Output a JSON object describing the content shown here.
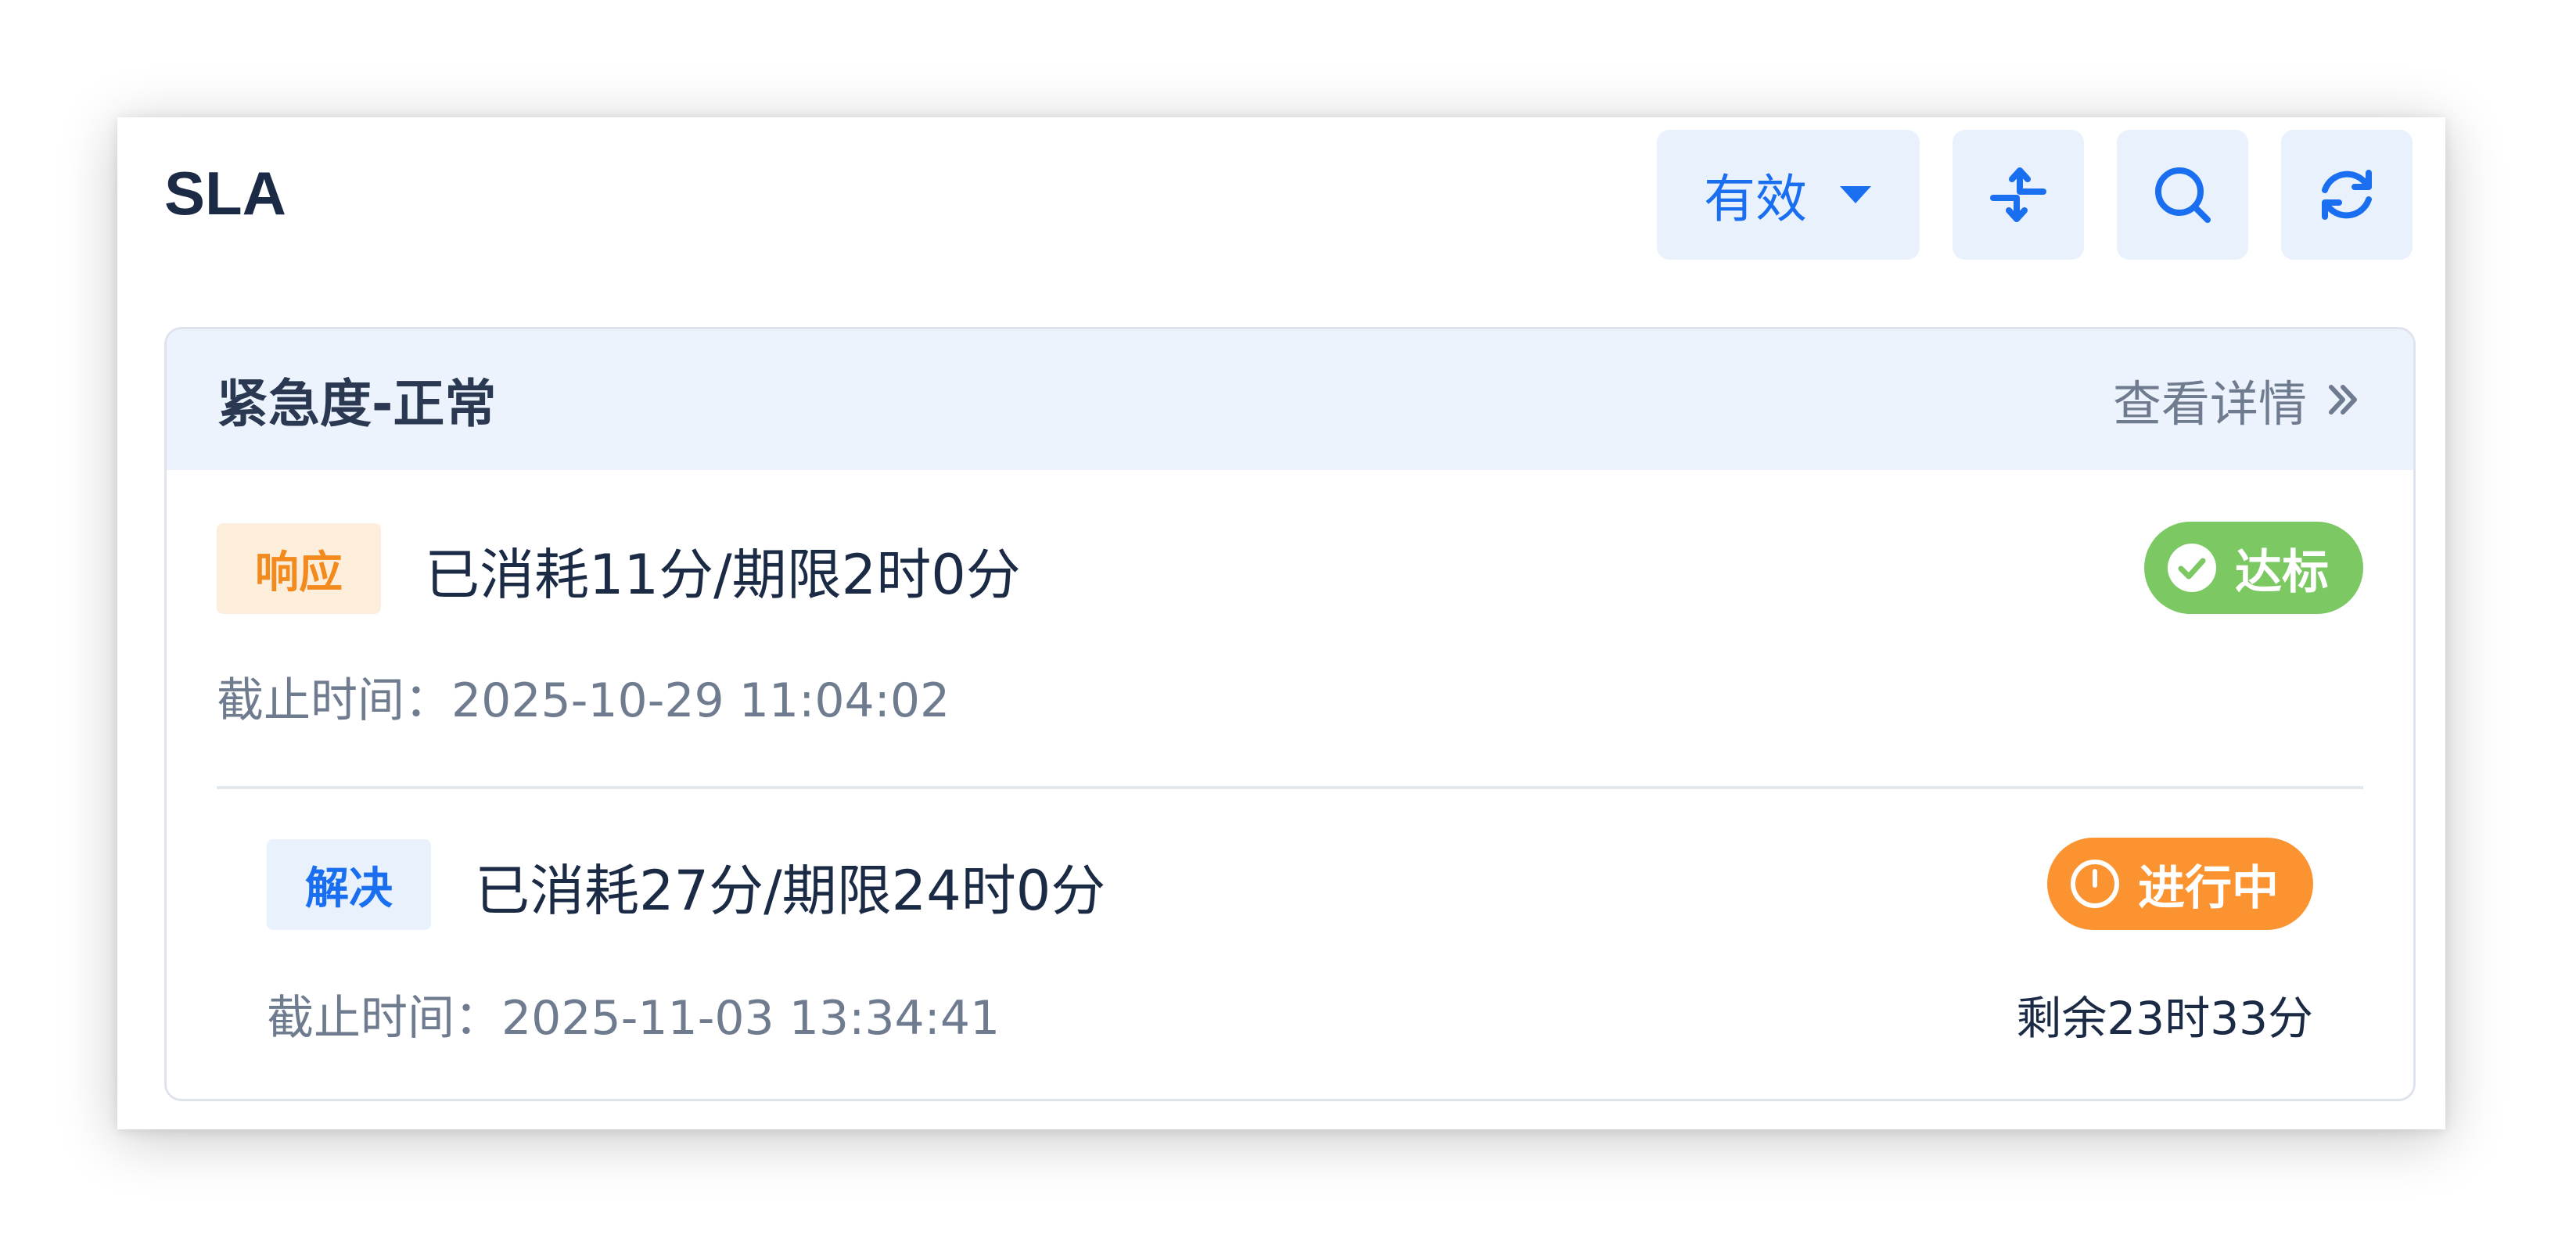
{
  "header": {
    "title": "SLA",
    "filter_label": "有效",
    "icons": [
      "sort-icon",
      "search-icon",
      "refresh-icon"
    ]
  },
  "sla_group": {
    "title": "紧急度-正常",
    "detail_label": "查看详情",
    "items": [
      {
        "tag": "响应",
        "summary": "已消耗11分/期限2时0分",
        "deadline": "截止时间：2025-10-29 11:04:02",
        "status": "达标",
        "status_icon": "check-circle-icon"
      },
      {
        "tag": "解决",
        "summary": "已消耗27分/期限24时0分",
        "deadline": "截止时间：2025-11-03 13:34:41",
        "status": "进行中",
        "status_icon": "clock-icon",
        "remaining": "剩余23时33分"
      }
    ]
  },
  "colors": {
    "accent": "#1a6ff0",
    "accent_bg": "#e9f1fd",
    "success": "#7cc964",
    "warning": "#fb9430"
  }
}
